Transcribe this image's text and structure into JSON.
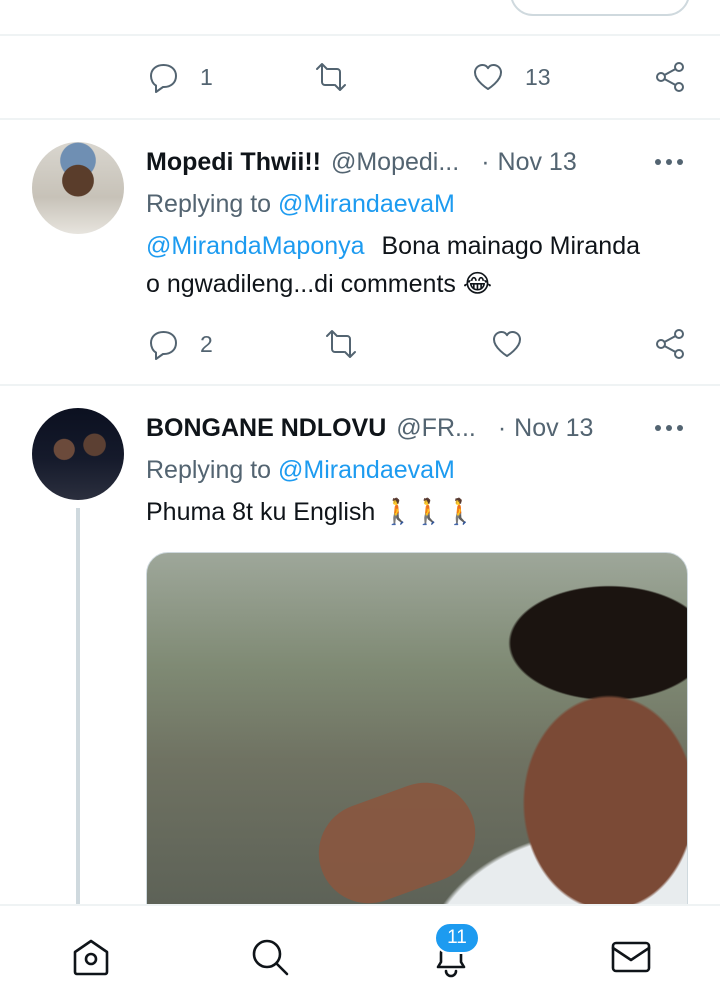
{
  "previous_tweet": {
    "actions": {
      "reply_count": "1",
      "retweet_count": "",
      "like_count": "13"
    }
  },
  "tweets": [
    {
      "name": "Mopedi Thwii!!",
      "handle": "@Mopedi...",
      "separator": "·",
      "date": "Nov 13",
      "replying_prefix": "Replying to",
      "replying_to": "@MirandaevaM",
      "mention": "@MirandaMaponya",
      "text_1": "Bona mainago Miranda",
      "text_2": "o ngwadileng...di comments 😂",
      "actions": {
        "reply_count": "2",
        "retweet_count": "",
        "like_count": ""
      }
    },
    {
      "name": "BONGANE NDLOVU",
      "handle": "@FR...",
      "separator": "·",
      "date": "Nov 13",
      "replying_prefix": "Replying to",
      "replying_to": "@MirandaevaM",
      "text_1": "Phuma 8t ku English 🚶🚶🚶"
    }
  ],
  "bottom_nav": {
    "items": [
      {
        "name": "home",
        "icon": "home-icon"
      },
      {
        "name": "search",
        "icon": "search-icon"
      },
      {
        "name": "notifications",
        "icon": "bell-icon",
        "badge": "11"
      },
      {
        "name": "messages",
        "icon": "mail-icon"
      }
    ]
  },
  "colors": {
    "link": "#1d9bf0",
    "muted": "#536471",
    "text": "#0f1419",
    "divider": "#eff3f4"
  }
}
